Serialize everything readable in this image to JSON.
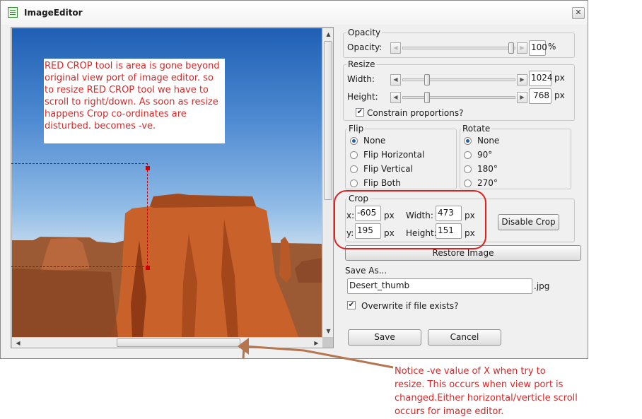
{
  "window": {
    "title": "ImageEditor",
    "close_label": "✕"
  },
  "image_note": "RED CROP tool is area is gone beyond original view port of image editor. so to resize RED CROP tool we have to scroll to right/down. As soon as resize happens Crop co-ordinates are disturbed. becomes -ve.",
  "opacity": {
    "legend": "Opacity",
    "label": "Opacity:",
    "value": "100",
    "unit": "%",
    "level": 1.0
  },
  "resize": {
    "legend": "Resize",
    "width_label": "Width:",
    "width_value": "1024",
    "height_label": "Height:",
    "height_value": "768",
    "unit": "px",
    "constrain_label": "Constrain proportions?",
    "constrain_checked": true
  },
  "flip": {
    "legend": "Flip",
    "options": [
      "None",
      "Flip Horizontal",
      "Flip Vertical",
      "Flip Both"
    ],
    "selected": "None"
  },
  "rotate": {
    "legend": "Rotate",
    "options": [
      "None",
      "90°",
      "180°",
      "270°"
    ],
    "selected": "None"
  },
  "crop": {
    "legend": "Crop",
    "x_label": "x:",
    "x_value": "-605",
    "y_label": "y:",
    "y_value": "195",
    "width_label": "Width:",
    "width_value": "473",
    "height_label": "Height:",
    "height_value": "151",
    "unit": "px",
    "disable_label": "Disable Crop"
  },
  "restore_label": "Restore Image",
  "save_as": {
    "label": "Save As...",
    "filename": "Desert_thumb",
    "ext": ".jpg",
    "overwrite_label": "Overwrite if file exists?",
    "overwrite_checked": true
  },
  "buttons": {
    "save": "Save",
    "cancel": "Cancel"
  },
  "annotation": "Notice -ve value of X when try to resize. This occurs when view port is changed.Either horizontal/verticle scroll occurs for image editor.",
  "colors": {
    "annotation_red": "#d62828",
    "highlight_red": "#e0201e",
    "arrow_brown": "#b5754f"
  }
}
